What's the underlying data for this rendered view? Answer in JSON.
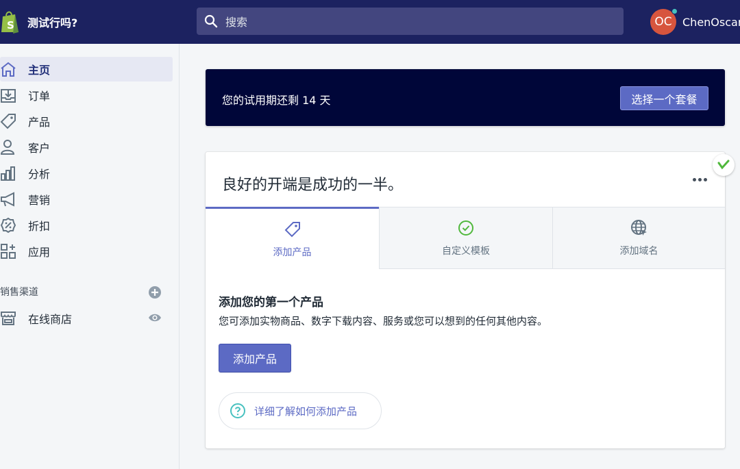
{
  "topbar": {
    "store_name": "测试行吗?",
    "search_placeholder": "搜索",
    "user_initials": "OC",
    "user_name": "ChenOscar"
  },
  "sidebar": {
    "items": [
      {
        "label": "主页",
        "icon": "home-icon",
        "active": true
      },
      {
        "label": "订单",
        "icon": "orders-icon"
      },
      {
        "label": "产品",
        "icon": "tag-icon"
      },
      {
        "label": "客户",
        "icon": "person-icon"
      },
      {
        "label": "分析",
        "icon": "bar-chart-icon"
      },
      {
        "label": "营销",
        "icon": "megaphone-icon"
      },
      {
        "label": "折扣",
        "icon": "discount-icon"
      },
      {
        "label": "应用",
        "icon": "apps-icon"
      }
    ],
    "channels_title": "销售渠道",
    "online_store": "在线商店"
  },
  "trial": {
    "text": "您的试用期还剩 14 天",
    "button": "选择一个套餐"
  },
  "card": {
    "title": "良好的开端是成功的一半。",
    "tabs": [
      {
        "label": "添加产品",
        "icon": "tag-icon",
        "active": true
      },
      {
        "label": "自定义模板",
        "icon": "check-circle-icon"
      },
      {
        "label": "添加域名",
        "icon": "globe-icon"
      }
    ],
    "panel": {
      "title": "添加您的第一个产品",
      "description": "您可添加实物商品、数字下载内容、服务或您可以想到的任何其他内容。",
      "button": "添加产品",
      "help": "详细了解如何添加产品"
    }
  },
  "colors": {
    "topbar": "#1c2260",
    "trial_bg": "#000639",
    "primary": "#5c6ac4",
    "success": "#50b83c",
    "help": "#47c1bf",
    "avatar": "#d7553e"
  }
}
